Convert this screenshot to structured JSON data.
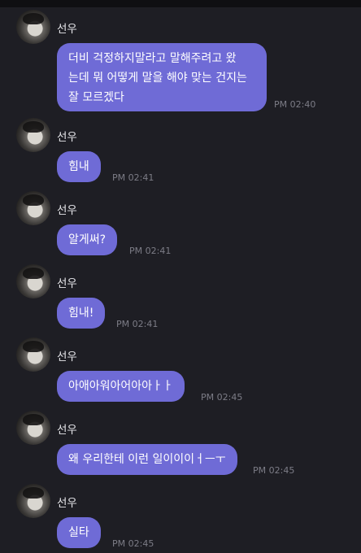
{
  "messages": [
    {
      "sender": "선우",
      "text": "더비 걱정하지말라고 말해주려고 왔\n는데 뭐 어떻게 말을 해야 맞는 건지는\n잘 모르겠다",
      "time": "PM 02:40"
    },
    {
      "sender": "선우",
      "text": "힘내",
      "time": "PM 02:41"
    },
    {
      "sender": "선우",
      "text": "알게써?",
      "time": "PM 02:41"
    },
    {
      "sender": "선우",
      "text": "힘내!",
      "time": "PM 02:41"
    },
    {
      "sender": "선우",
      "text": "아애아워아어아아ㅏㅏ",
      "time": "PM 02:45"
    },
    {
      "sender": "선우",
      "text": "왜 우리한테 이런 일이이이ㅓㅡㅜ",
      "time": "PM 02:45"
    },
    {
      "sender": "선우",
      "text": "실타",
      "time": "PM 02:45"
    }
  ]
}
